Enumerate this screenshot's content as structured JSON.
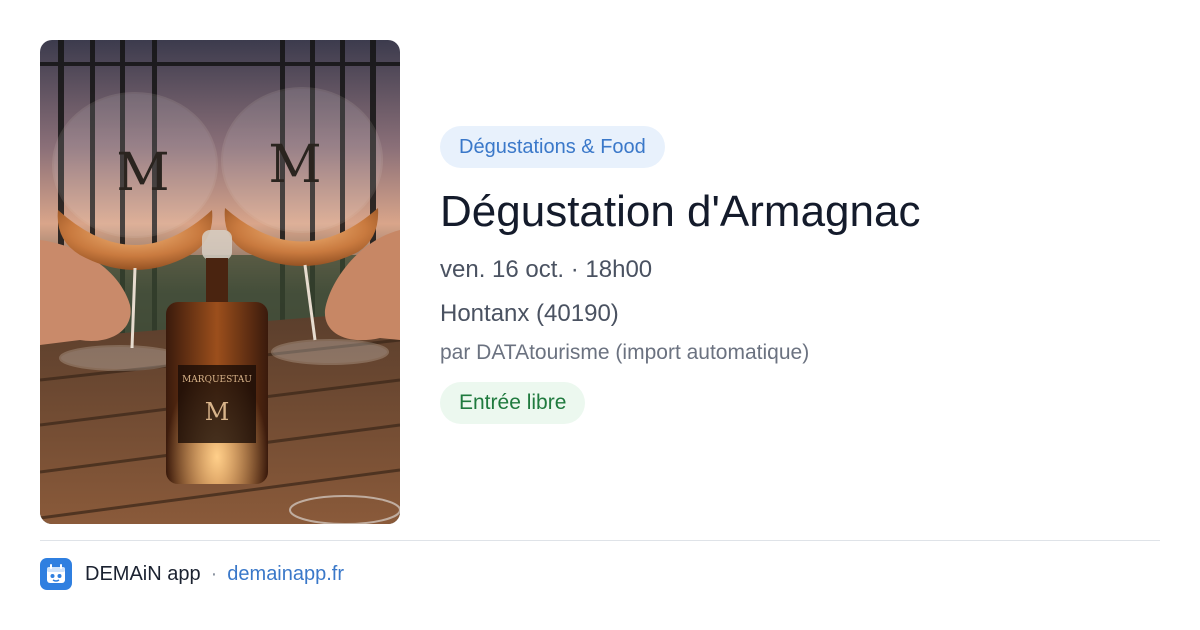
{
  "event": {
    "category": "Dégustations & Food",
    "title": "Dégustation d'Armagnac",
    "datetime": "ven. 16 oct. · 18h00",
    "location": "Hontanx (40190)",
    "source": "par DATAtourisme (import automatique)",
    "price": "Entrée libre"
  },
  "photo": {
    "glass_monogram": "M",
    "bottle_brand": "MARQUESTAU",
    "bottle_monogram": "M"
  },
  "footer": {
    "app_name": "DEMAiN app",
    "separator": "·",
    "domain": "demainapp.fr"
  },
  "colors": {
    "category_bg": "#e8f1fc",
    "category_text": "#3a78c9",
    "price_bg": "#ecf8ef",
    "price_text": "#1f7a3e",
    "title_text": "#141b2b",
    "link": "#3a78c9",
    "app_icon_bg": "#2f7fe0"
  }
}
